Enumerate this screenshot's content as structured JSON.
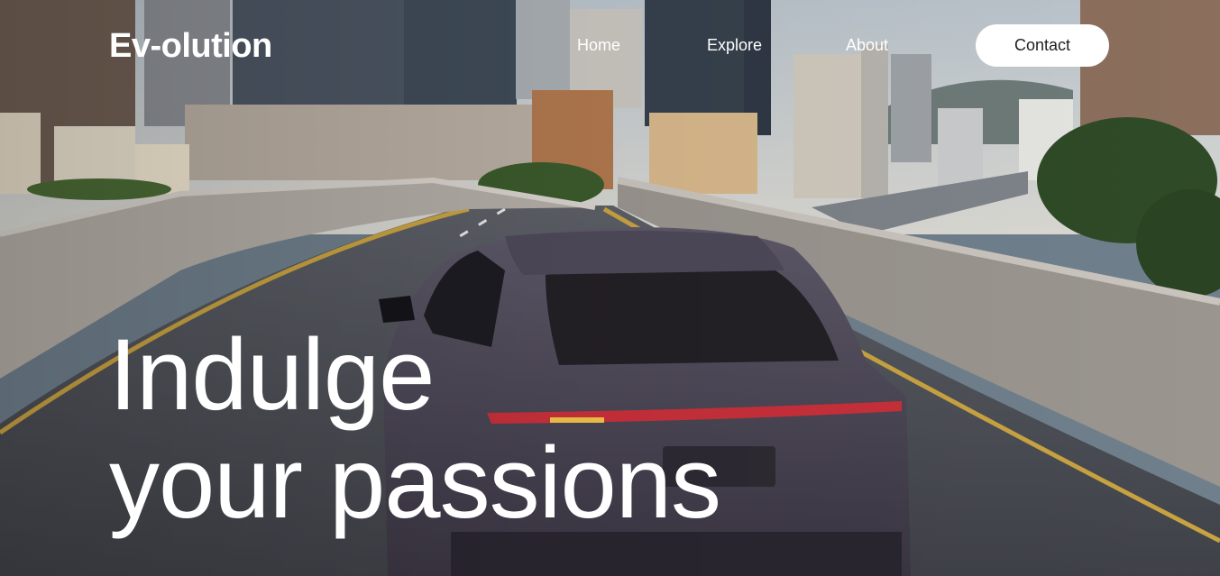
{
  "brand": {
    "logo_text": "Ev-olution"
  },
  "nav": {
    "items": [
      {
        "label": "Home"
      },
      {
        "label": "Explore"
      },
      {
        "label": "About"
      }
    ],
    "contact_label": "Contact"
  },
  "hero": {
    "headline_line1": "Indulge",
    "headline_line2": "your passions",
    "background": "city-overpass-car-image"
  },
  "colors": {
    "text": "#ffffff",
    "button_bg": "#ffffff",
    "button_text": "#222222"
  }
}
